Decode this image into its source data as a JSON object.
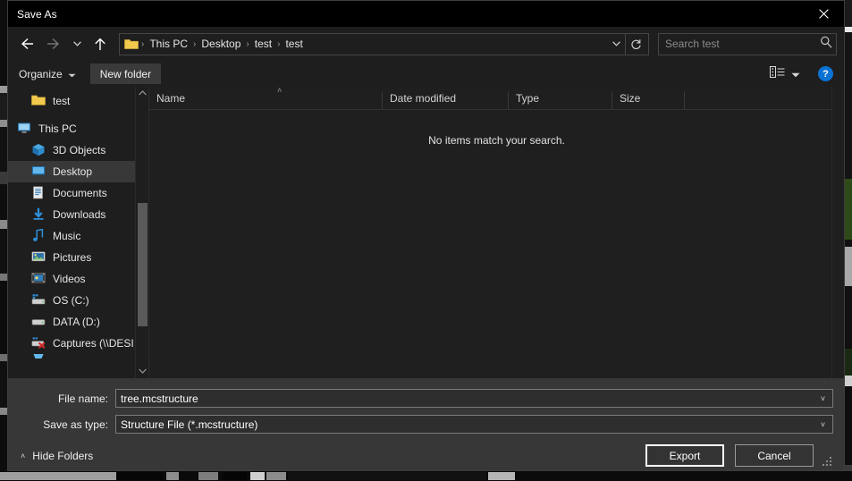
{
  "window": {
    "title": "Save As",
    "close_icon": "close-icon"
  },
  "nav": {
    "back_icon": "arrow-left-icon",
    "forward_icon": "arrow-right-icon",
    "recent_icon": "chevron-down-icon",
    "up_icon": "arrow-up-icon",
    "refresh_icon": "refresh-icon",
    "address_chevron_icon": "chevron-down-icon",
    "breadcrumbs": [
      "This PC",
      "Desktop",
      "test",
      "test"
    ],
    "separator": "›"
  },
  "search": {
    "placeholder": "Search test",
    "value": "",
    "icon": "search-icon"
  },
  "commandbar": {
    "organize_label": "Organize",
    "organize_caret": "▼",
    "new_folder_label": "New folder",
    "view_icon": "view-options-icon",
    "view_caret": "▼",
    "help_label": "?"
  },
  "sidebar": {
    "items": [
      {
        "label": "test",
        "icon": "folder-icon",
        "indent": "child",
        "selected": false
      },
      {
        "label": "This PC",
        "icon": "monitor-icon",
        "indent": "root",
        "selected": false
      },
      {
        "label": "3D Objects",
        "icon": "cube-icon",
        "indent": "child",
        "selected": false
      },
      {
        "label": "Desktop",
        "icon": "desktop-icon",
        "indent": "child",
        "selected": true
      },
      {
        "label": "Documents",
        "icon": "documents-icon",
        "indent": "child",
        "selected": false
      },
      {
        "label": "Downloads",
        "icon": "download-icon",
        "indent": "child",
        "selected": false
      },
      {
        "label": "Music",
        "icon": "music-note-icon",
        "indent": "child",
        "selected": false
      },
      {
        "label": "Pictures",
        "icon": "picture-icon",
        "indent": "child",
        "selected": false
      },
      {
        "label": "Videos",
        "icon": "video-icon",
        "indent": "child",
        "selected": false
      },
      {
        "label": "OS (C:)",
        "icon": "hard-drive-icon",
        "indent": "child",
        "selected": false
      },
      {
        "label": "DATA (D:)",
        "icon": "hard-drive-icon",
        "indent": "child",
        "selected": false
      },
      {
        "label": "Captures (\\\\DESI",
        "icon": "network-drive-icon",
        "indent": "child",
        "selected": false
      }
    ],
    "scroll_up_icon": "chevron-up-icon",
    "scroll_down_icon": "chevron-down-icon"
  },
  "filelist": {
    "columns": [
      {
        "label": "Name"
      },
      {
        "label": "Date modified"
      },
      {
        "label": "Type"
      },
      {
        "label": "Size"
      }
    ],
    "sort_indicator": "˄",
    "empty_message": "No items match your search.",
    "rows": []
  },
  "form": {
    "filename_label": "File name:",
    "filename_value": "tree.mcstructure",
    "filetype_label": "Save as type:",
    "filetype_value": "Structure File (*.mcstructure)",
    "dropdown_caret": "˅",
    "hide_folders_label": "Hide Folders",
    "hide_folders_caret": "˄",
    "export_label": "Export",
    "cancel_label": "Cancel"
  },
  "colors": {
    "window_bg": "#1e1e1e",
    "titlebar_bg": "#000000",
    "panel_bg": "#373737",
    "selection_bg": "#383838",
    "accent_blue": "#0b72d4",
    "text": "#e6e6e6",
    "folder_yellow": "#f2c94c"
  }
}
